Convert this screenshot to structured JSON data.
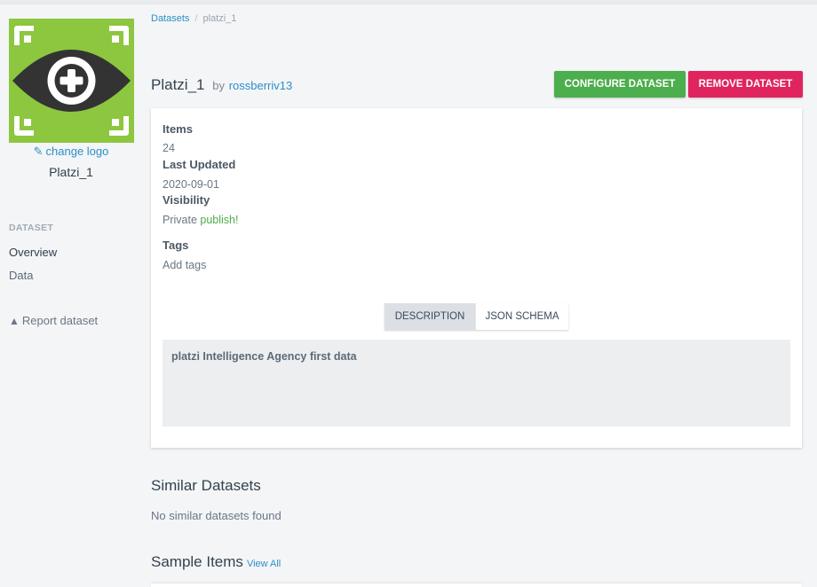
{
  "breadcrumb": {
    "root": "Datasets",
    "separator": "/",
    "current": "platzi_1"
  },
  "dataset": {
    "name": "Platzi_1",
    "by_label": "by",
    "owner": "rossberriv13"
  },
  "actions": {
    "configure": "CONFIGURE DATASET",
    "remove": "REMOVE DATASET"
  },
  "sidebar": {
    "change_logo": "change logo",
    "name": "Platzi_1",
    "section": "DATASET",
    "items": [
      {
        "label": "Overview",
        "active": true
      },
      {
        "label": "Data",
        "active": false
      }
    ],
    "report": "Report dataset"
  },
  "info": {
    "items_label": "Items",
    "items_value": "24",
    "updated_label": "Last Updated",
    "updated_value": "2020-09-01",
    "visibility_label": "Visibility",
    "visibility_value": "Private",
    "publish_link": "publish!",
    "tags_label": "Tags",
    "tags_value": "Add tags"
  },
  "tabs": [
    {
      "label": "DESCRIPTION",
      "selected": true
    },
    {
      "label": "JSON SCHEMA",
      "selected": false
    }
  ],
  "description": "platzi Intelligence Agency first data",
  "similar": {
    "title": "Similar Datasets",
    "empty": "No similar datasets found"
  },
  "sample": {
    "title": "Sample Items",
    "view_all": "View All"
  },
  "colors": {
    "logo_bg": "#8dc63f",
    "configure": "#4cae4c",
    "remove": "#e0245e",
    "link": "#2a8fc7"
  }
}
